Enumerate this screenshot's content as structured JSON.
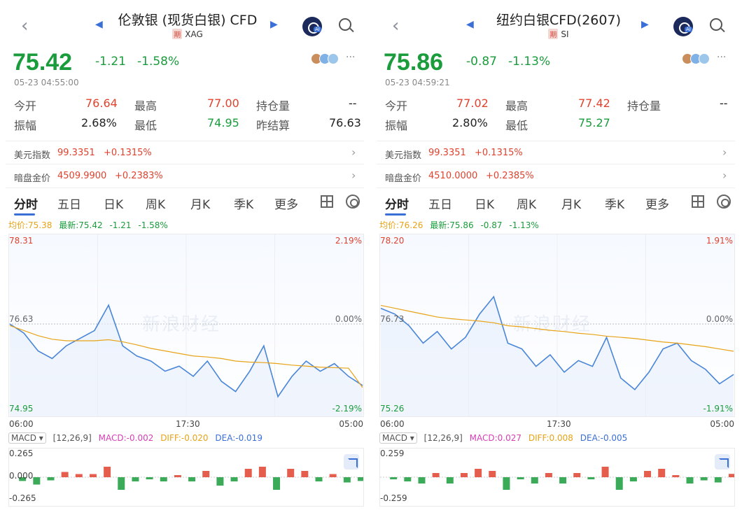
{
  "colors": {
    "up": "#e0422e",
    "down": "#1a9c3c",
    "line": "#4a86d8",
    "avg": "#e8a317",
    "macd": "#d63fb5",
    "diff": "#e8a317",
    "dea": "#3b6fd8"
  },
  "panels": [
    {
      "title": "伦敦银 (现货白银) CFD",
      "tag": "期",
      "code": "XAG",
      "price": "75.42",
      "change": "-1.21",
      "change_pct": "-1.58%",
      "timestamp": "05-23 04:55:00",
      "stats": {
        "open_label": "今开",
        "open": "76.64",
        "high_label": "最高",
        "high": "77.00",
        "oi_label": "持仓量",
        "oi": "--",
        "amp_label": "振幅",
        "amp": "2.68%",
        "low_label": "最低",
        "low": "74.95",
        "prev_label": "昨结算",
        "prev": "76.63"
      },
      "refs": [
        {
          "label": "美元指数",
          "value": "99.3351",
          "change": "+0.1315%"
        },
        {
          "label": "暗盘金价",
          "value": "4509.9900",
          "change": "+0.2383%"
        }
      ],
      "tabs": [
        "分时",
        "五日",
        "日K",
        "周K",
        "月K",
        "季K",
        "更多"
      ],
      "legend": {
        "avg": "均价:75.38",
        "latest": "最新:75.42",
        "chg": "-1.21",
        "pct": "-1.58%"
      },
      "chart": {
        "ymax": "78.31",
        "ymid": "76.63",
        "ymin": "74.95",
        "pmax": "2.19%",
        "pmid": "0.00%",
        "pmin": "-2.19%",
        "xstart": "06:00",
        "xmid": "17:30",
        "xend": "05:00"
      },
      "watermark": "新浪财经",
      "macd": {
        "select": "MACD",
        "params": "[12,26,9]",
        "macd": "MACD:-0.002",
        "diff": "DIFF:-0.020",
        "dea": "DEA:-0.019",
        "ymax": "0.265",
        "ymid": "0.000",
        "ymin": "-0.265"
      },
      "chart_data": {
        "type": "line",
        "title": "伦敦银 (现货白银) CFD",
        "xlabel": "",
        "ylabel": "",
        "x_ticks": [
          "06:00",
          "17:30",
          "05:00"
        ],
        "ylim": [
          74.95,
          78.31
        ],
        "ref_value": 76.63,
        "series": [
          {
            "name": "最新",
            "values": [
              76.63,
              76.45,
              76.1,
              75.95,
              76.2,
              76.35,
              76.5,
              77.0,
              76.2,
              76.0,
              75.9,
              75.7,
              75.8,
              75.6,
              75.9,
              75.5,
              75.3,
              75.7,
              76.2,
              75.2,
              75.6,
              75.9,
              75.7,
              75.85,
              75.6,
              75.42
            ]
          },
          {
            "name": "均价",
            "values": [
              76.6,
              76.5,
              76.4,
              76.33,
              76.3,
              76.3,
              76.3,
              76.32,
              76.28,
              76.22,
              76.15,
              76.1,
              76.05,
              76.0,
              75.98,
              75.95,
              75.9,
              75.88,
              75.87,
              75.85,
              75.82,
              75.8,
              75.78,
              75.77,
              75.76,
              75.38
            ]
          }
        ]
      }
    },
    {
      "title": "纽约白银CFD(2607)",
      "tag": "期",
      "code": "SI",
      "price": "75.86",
      "change": "-0.87",
      "change_pct": "-1.13%",
      "timestamp": "05-23 04:59:21",
      "stats": {
        "open_label": "今开",
        "open": "77.02",
        "high_label": "最高",
        "high": "77.42",
        "oi_label": "持仓量",
        "oi": "--",
        "amp_label": "振幅",
        "amp": "2.80%",
        "low_label": "最低",
        "low": "75.27",
        "prev_label": "",
        "prev": ""
      },
      "refs": [
        {
          "label": "美元指数",
          "value": "99.3351",
          "change": "+0.1315%"
        },
        {
          "label": "暗盘金价",
          "value": "4510.0000",
          "change": "+0.2385%"
        }
      ],
      "tabs": [
        "分时",
        "五日",
        "日K",
        "周K",
        "月K",
        "季K",
        "更多"
      ],
      "legend": {
        "avg": "均价:76.26",
        "latest": "最新:75.86",
        "chg": "-0.87",
        "pct": "-1.13%"
      },
      "chart": {
        "ymax": "78.20",
        "ymid": "76.73",
        "ymin": "75.26",
        "pmax": "1.91%",
        "pmid": "0.00%",
        "pmin": "-1.91%",
        "xstart": "06:00",
        "xmid": "17:30",
        "xend": "05:00"
      },
      "watermark": "新浪财经",
      "macd": {
        "select": "MACD",
        "params": "[12,26,9]",
        "macd": "MACD:0.027",
        "diff": "DIFF:0.008",
        "dea": "DEA:-0.005",
        "ymax": "0.259",
        "ymid": "",
        "ymin": "-0.259"
      },
      "chart_data": {
        "type": "line",
        "title": "纽约白银CFD(2607)",
        "xlabel": "",
        "ylabel": "",
        "x_ticks": [
          "06:00",
          "17:30",
          "05:00"
        ],
        "ylim": [
          75.26,
          78.2
        ],
        "ref_value": 76.73,
        "series": [
          {
            "name": "最新",
            "values": [
              77.0,
              76.9,
              76.7,
              76.4,
              76.6,
              76.3,
              76.5,
              76.9,
              77.2,
              76.4,
              76.3,
              76.0,
              76.2,
              75.9,
              76.1,
              76.0,
              76.5,
              75.8,
              75.6,
              75.9,
              76.3,
              76.4,
              76.1,
              75.95,
              75.7,
              75.86
            ]
          },
          {
            "name": "均价",
            "values": [
              77.05,
              77.0,
              76.95,
              76.9,
              76.85,
              76.82,
              76.8,
              76.78,
              76.75,
              76.7,
              76.68,
              76.65,
              76.62,
              76.6,
              76.57,
              76.55,
              76.52,
              76.5,
              76.48,
              76.45,
              76.42,
              76.4,
              76.37,
              76.34,
              76.3,
              76.26
            ]
          }
        ]
      }
    }
  ]
}
